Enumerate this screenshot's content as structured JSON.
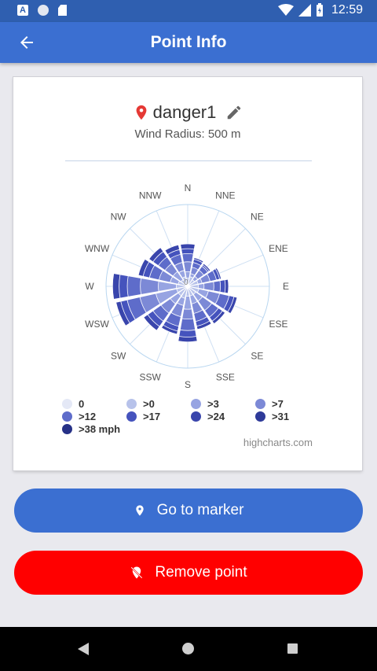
{
  "status_bar": {
    "time": "12:59",
    "a_icon_text": "A"
  },
  "app_bar": {
    "title": "Point Info"
  },
  "point": {
    "name": "danger1",
    "subtitle": "Wind Radius: 500 m"
  },
  "chart_data": {
    "type": "windrose",
    "directions": [
      "N",
      "NNE",
      "NE",
      "ENE",
      "E",
      "ESE",
      "SE",
      "SSE",
      "S",
      "SSW",
      "SW",
      "WSW",
      "W",
      "WNW",
      "NW",
      "NNW"
    ],
    "center_label": "0",
    "legend": [
      {
        "label": "0",
        "color": "#e4e8f6"
      },
      {
        "label": ">0",
        "color": "#b7c2ea"
      },
      {
        "label": ">3",
        "color": "#97a4e2"
      },
      {
        "label": ">7",
        "color": "#7c89d6"
      },
      {
        "label": ">12",
        "color": "#5e6cca"
      },
      {
        "label": ">17",
        "color": "#4553bd"
      },
      {
        "label": ">24",
        "color": "#3945ac"
      },
      {
        "label": ">31",
        "color": "#2e3a99"
      },
      {
        "label": ">38 mph",
        "color": "#263187"
      }
    ],
    "series": [
      {
        "name": "0",
        "values": [
          0,
          0,
          0,
          0,
          0,
          0,
          0,
          0,
          0,
          0,
          0,
          0,
          0,
          0,
          0,
          0
        ]
      },
      {
        "name": ">0",
        "values": [
          10,
          12,
          10,
          13,
          13,
          14,
          12,
          12,
          12,
          15,
          14,
          14,
          14,
          12,
          10,
          12
        ]
      },
      {
        "name": ">3",
        "values": [
          18,
          16,
          15,
          18,
          20,
          26,
          22,
          22,
          28,
          24,
          26,
          40,
          36,
          22,
          22,
          20
        ]
      },
      {
        "name": ">7",
        "values": [
          30,
          24,
          24,
          28,
          32,
          40,
          36,
          34,
          40,
          38,
          40,
          60,
          58,
          36,
          34,
          30
        ]
      },
      {
        "name": ">12",
        "values": [
          40,
          30,
          30,
          36,
          40,
          52,
          46,
          44,
          54,
          50,
          52,
          76,
          74,
          48,
          44,
          40
        ]
      },
      {
        "name": ">17",
        "values": [
          46,
          34,
          32,
          40,
          46,
          58,
          52,
          50,
          62,
          56,
          60,
          84,
          84,
          56,
          52,
          46
        ]
      },
      {
        "name": ">24",
        "values": [
          52,
          36,
          34,
          42,
          50,
          62,
          56,
          54,
          68,
          60,
          66,
          90,
          92,
          62,
          58,
          52
        ]
      },
      {
        "name": ">31",
        "values": [
          0,
          0,
          0,
          0,
          0,
          0,
          0,
          0,
          0,
          0,
          0,
          0,
          0,
          0,
          0,
          0
        ]
      },
      {
        "name": ">38 mph",
        "values": [
          0,
          0,
          0,
          0,
          0,
          0,
          0,
          0,
          0,
          0,
          0,
          0,
          0,
          0,
          0,
          0
        ]
      }
    ],
    "credits": "highcharts.com"
  },
  "buttons": {
    "go_to_marker": "Go to marker",
    "remove_point": "Remove point"
  },
  "icons": {
    "back": "arrow-back-icon",
    "pin": "location-pin-icon",
    "edit": "pencil-icon",
    "go": "map-marker-icon",
    "remove": "location-off-icon"
  },
  "colors": {
    "primary": "#3b6fd1",
    "danger": "#ff0000",
    "pin": "#e53935"
  }
}
